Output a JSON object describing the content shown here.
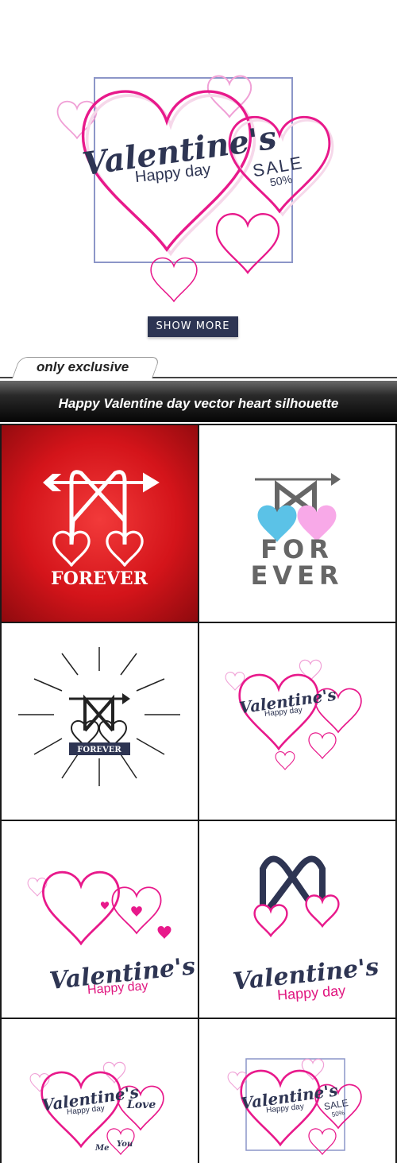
{
  "hero": {
    "script_title": "Valentine's",
    "subtitle": "Happy day",
    "sale_label": "SALE",
    "sale_percent": "50%",
    "button_label": "SHOW MORE"
  },
  "tag": {
    "label": "only exclusive"
  },
  "banner": {
    "title": "Happy Valentine day vector heart silhouette"
  },
  "tiles": {
    "t1_label": "FOREVER",
    "t2_line1": "FOR",
    "t2_line2": "EVER",
    "t3_label": "FOREVER",
    "t4_script": "Valentine's",
    "t4_sub": "Happy day",
    "t5_script": "Valentine's",
    "t5_sub": "Happy day",
    "t6_script": "Valentine's",
    "t6_sub": "Happy day",
    "t7_script": "Valentine's",
    "t7_sub": "Happy day",
    "t7_love": "Love",
    "t7_me": "Me",
    "t7_you": "You",
    "t8_script": "Valentine's",
    "t8_sub": "Happy day",
    "t8_sale": "SALE",
    "t8_pct": "50%"
  },
  "colors": {
    "pink": "#e8198b",
    "navy": "#2e3553",
    "red": "#d1171b",
    "blue": "#5bc2e7",
    "lightpink": "#f8a9e8"
  }
}
